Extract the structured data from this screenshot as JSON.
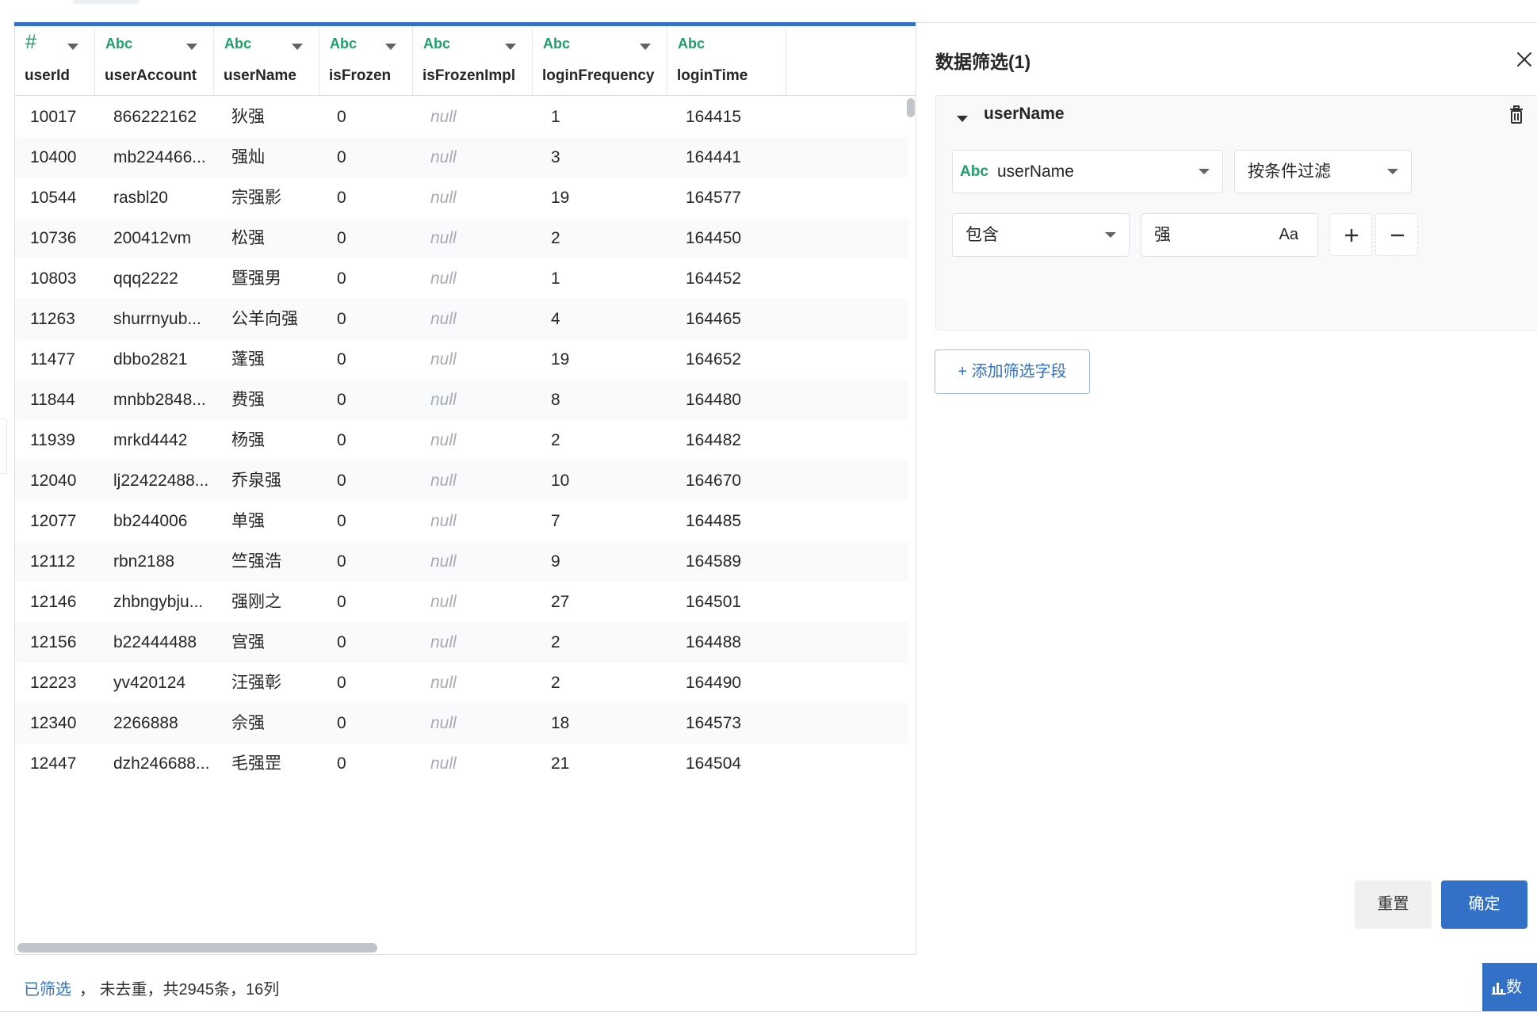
{
  "columns": [
    {
      "type": "#",
      "name": "userId"
    },
    {
      "type": "Abc",
      "name": "userAccount"
    },
    {
      "type": "Abc",
      "name": "userName"
    },
    {
      "type": "Abc",
      "name": "isFrozen"
    },
    {
      "type": "Abc",
      "name": "isFrozenImpl"
    },
    {
      "type": "Abc",
      "name": "loginFrequency"
    },
    {
      "type": "Abc",
      "name": "loginTime"
    }
  ],
  "rows": [
    [
      "10017",
      "866222162",
      "狄强",
      "0",
      "null",
      "1",
      "164415"
    ],
    [
      "10400",
      "mb224466...",
      "强灿",
      "0",
      "null",
      "3",
      "164441"
    ],
    [
      "10544",
      "rasbl20",
      "宗强影",
      "0",
      "null",
      "19",
      "164577"
    ],
    [
      "10736",
      "200412vm",
      "松强",
      "0",
      "null",
      "2",
      "164450"
    ],
    [
      "10803",
      "qqq2222",
      "暨强男",
      "0",
      "null",
      "1",
      "164452"
    ],
    [
      "11263",
      "shurrnyub...",
      "公羊向强",
      "0",
      "null",
      "4",
      "164465"
    ],
    [
      "11477",
      "dbbo2821",
      "蓬强",
      "0",
      "null",
      "19",
      "164652"
    ],
    [
      "11844",
      "mnbb2848...",
      "费强",
      "0",
      "null",
      "8",
      "164480"
    ],
    [
      "11939",
      "mrkd4442",
      "杨强",
      "0",
      "null",
      "2",
      "164482"
    ],
    [
      "12040",
      "lj22422488...",
      "乔泉强",
      "0",
      "null",
      "10",
      "164670"
    ],
    [
      "12077",
      "bb244006",
      "单强",
      "0",
      "null",
      "7",
      "164485"
    ],
    [
      "12112",
      "rbn2188",
      "竺强浩",
      "0",
      "null",
      "9",
      "164589"
    ],
    [
      "12146",
      "zhbngybju...",
      "强刚之",
      "0",
      "null",
      "27",
      "164501"
    ],
    [
      "12156",
      "b22444488",
      "宫强",
      "0",
      "null",
      "2",
      "164488"
    ],
    [
      "12223",
      "yv420124",
      "汪强彰",
      "0",
      "null",
      "2",
      "164490"
    ],
    [
      "12340",
      "2266888",
      "佘强",
      "0",
      "null",
      "18",
      "164573"
    ],
    [
      "12447",
      "dzh246688...",
      "毛强罡",
      "0",
      "null",
      "21",
      "164504"
    ]
  ],
  "filter_panel": {
    "title": "数据筛选(1)",
    "field_name": "userName",
    "field_type": "Abc",
    "field_select": "userName",
    "mode_select": "按条件过滤",
    "operator_select": "包含",
    "value": "强",
    "case_label": "Aa",
    "add_field_label": "+ 添加筛选字段",
    "reset_label": "重置",
    "confirm_label": "确定"
  },
  "footer": {
    "filtered_link": "已筛选",
    "summary": "，  未去重，共2945条，16列",
    "data_button": "数"
  },
  "colors": {
    "accent": "#3370c7",
    "type_green": "#1e9f68",
    "null_gray": "#a8abb2"
  }
}
